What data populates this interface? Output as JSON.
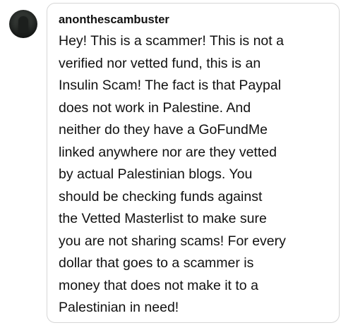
{
  "reply": {
    "username": "anonthescambuster",
    "lines": [
      "Hey! This is a scammer! This is not a",
      "verified nor vetted fund, this is an",
      "Insulin Scam! The fact is that Paypal",
      "does not work in Palestine. And",
      "neither do they have a GoFundMe",
      "linked anywhere nor are they vetted",
      "by actual Palestinian blogs. You",
      "should be checking funds against",
      "the Vetted Masterlist to make sure",
      "you are not sharing scams! For every",
      "dollar that goes to a scammer is",
      "money that does not make it to a",
      "Palestinian in need!"
    ]
  },
  "colors": {
    "text": "#111111",
    "bubble_border": "#d6d6d6",
    "background": "#ffffff"
  },
  "icons": {
    "avatar": "user-avatar"
  }
}
